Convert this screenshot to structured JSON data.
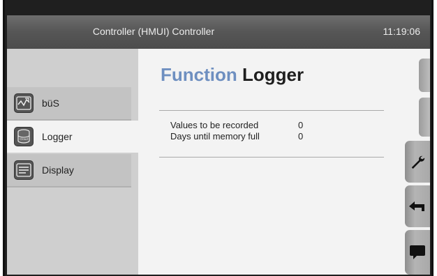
{
  "header": {
    "title": "Controller (HMUI) Controller",
    "clock": "11:19:06"
  },
  "page": {
    "title_part1": "Function",
    "title_part2": "Logger"
  },
  "sidebar": {
    "items": [
      {
        "label": "büS",
        "icon": "bus-network-icon"
      },
      {
        "label": "Logger",
        "icon": "cloud-database-icon",
        "icon_text": "Cloud",
        "active": true
      },
      {
        "label": "Display",
        "icon": "display-icon"
      }
    ]
  },
  "info": {
    "rows": [
      {
        "label": "Values to be recorded",
        "value": "0"
      },
      {
        "label": "Days until memory full",
        "value": "0"
      }
    ]
  },
  "right_buttons": [
    {
      "icon": "wrench-icon"
    },
    {
      "icon": "back-arrow-icon"
    },
    {
      "icon": "message-icon"
    }
  ],
  "colors": {
    "accent": "#6e8fc0",
    "titlebar": "#5a5a5a"
  }
}
